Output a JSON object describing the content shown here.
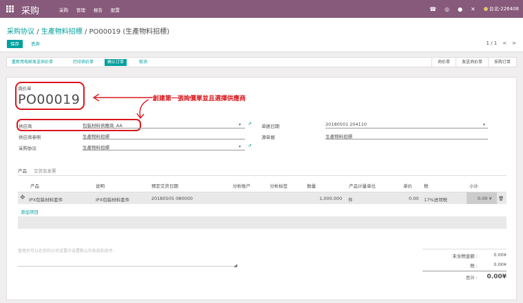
{
  "topbar": {
    "app_title": "采购",
    "menu": [
      "采购",
      "管理",
      "报告",
      "配置"
    ],
    "user": "台北-226408"
  },
  "breadcrumb": {
    "items": [
      "采购协议",
      "生產物料招標",
      "PO00019 (生產物料招標)"
    ]
  },
  "buttons": {
    "save": "保存",
    "discard": "丢弃"
  },
  "pager": {
    "value": "1 / 1",
    "prev": "<",
    "next": ">"
  },
  "statusbar": {
    "actions": [
      "重新用电邮发送询价单",
      "打印询价单",
      "确认订单",
      "取消"
    ],
    "steps": [
      "询价单",
      "发送询价单",
      "采购订单"
    ]
  },
  "form": {
    "rfq_label": "询价单",
    "name": "PO00019",
    "vendor_label": "供应商",
    "vendor_value": "包裝材料供應商_AA",
    "vendor_ref_label": "供应商参照",
    "vendor_ref_value": "生產物料招標",
    "requisition_label": "采购协议",
    "requisition_value": "生產物料招標",
    "order_date_label": "单据日期",
    "order_date_value": "20180501 204110",
    "origin_label": "源单据",
    "origin_value": "生產物料招標"
  },
  "annotation": {
    "text": "創建第一張詢價單並且選擇供應商"
  },
  "tabs": [
    "产品",
    "交货及发票"
  ],
  "table": {
    "headers": [
      "产品",
      "说明",
      "预定交货日期",
      "分析账户",
      "分析标签",
      "数量",
      "产品计量单位",
      "单价",
      "税",
      "小计"
    ],
    "row": {
      "product": "IPX包裝材料套件",
      "description": "IPX包裝材料套件",
      "date": "20180505 080000",
      "qty": "1,000.000",
      "uom": "件",
      "price": "0.00",
      "tax": "17%进项税",
      "subtotal": "0.00 ¥"
    },
    "add_line": "添加项目"
  },
  "notes_placeholder": "管理员可以在你的公司设置中设置默认的条款和条件.",
  "totals": {
    "untaxed_label": "未含税金额 :",
    "untaxed_value": "0.00¥",
    "tax_label": "税 :",
    "tax_value": "0.00¥",
    "total_label": "总计 :",
    "total_value": "0.00¥"
  }
}
